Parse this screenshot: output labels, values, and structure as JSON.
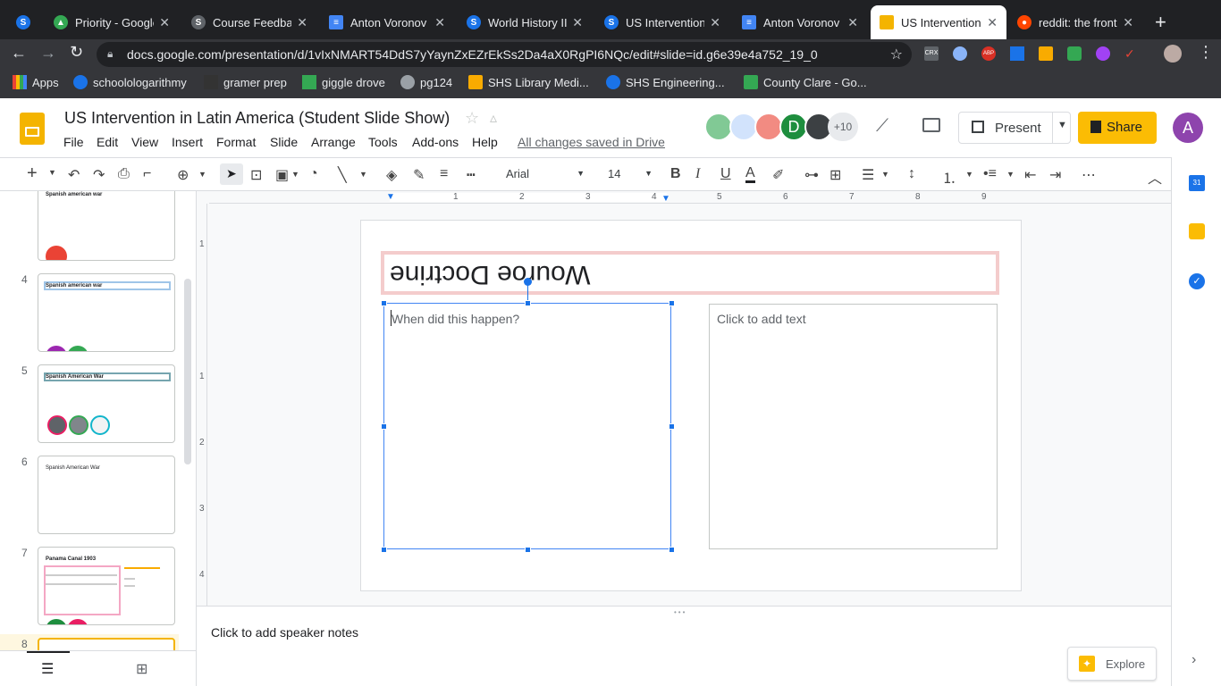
{
  "browser": {
    "tabs": [
      {
        "label": "Priority - Google",
        "color": "#1a73e8",
        "icon": "drive-icon"
      },
      {
        "label": "Course Feedback",
        "color": "#5f6368",
        "icon": "schoology-icon"
      },
      {
        "label": "Anton Voronov",
        "color": "#4285f4",
        "icon": "docs-icon"
      },
      {
        "label": "World History II",
        "color": "#1a73e8",
        "icon": "schoology-icon"
      },
      {
        "label": "US Intervention",
        "color": "#1a73e8",
        "icon": "schoology-icon"
      },
      {
        "label": "Anton Voronov",
        "color": "#4285f4",
        "icon": "docs-icon"
      },
      {
        "label": "US Intervention",
        "color": "#f4b400",
        "icon": "slides-icon",
        "active": true
      },
      {
        "label": "reddit: the front",
        "color": "#ff4500",
        "icon": "reddit-icon"
      }
    ],
    "url": "docs.google.com/presentation/d/1vIxNMART54DdS7yYaynZxEZrEkSs2Da4aX0RgPI6NQc/edit#slide=id.g6e39e4a752_19_0",
    "bookmarks": [
      "Apps",
      "schoolologarithmy",
      "gramer prep",
      "giggle drove",
      "pg124",
      "SHS Library Medi...",
      "SHS Engineering...",
      "County Clare - Go..."
    ]
  },
  "doc": {
    "title": "US Intervention in Latin America (Student Slide Show)",
    "menus": [
      "File",
      "Edit",
      "View",
      "Insert",
      "Format",
      "Slide",
      "Arrange",
      "Tools",
      "Add-ons",
      "Help"
    ],
    "saved_status": "All changes saved in Drive",
    "collaborators_more": "+10",
    "collab_initial": "D",
    "present_label": "Present",
    "share_label": "Share",
    "account_initial": "A"
  },
  "toolbar": {
    "font": "Arial",
    "font_size": "14"
  },
  "ruler": [
    "1",
    "2",
    "3",
    "4",
    "5",
    "6",
    "7",
    "8",
    "9"
  ],
  "filmstrip": {
    "slides": [
      {
        "num": "",
        "title": "Spanish american war"
      },
      {
        "num": "4",
        "title": "Spanish american war"
      },
      {
        "num": "5",
        "title": "Spanish American War"
      },
      {
        "num": "6",
        "title": "Spanish American War"
      },
      {
        "num": "7",
        "title": "Panama Canal 1903"
      },
      {
        "num": "8",
        "title": ""
      }
    ]
  },
  "slide": {
    "title": "Wouroe Doctrine",
    "left_placeholder": "When did this happen?",
    "right_placeholder": "Click to add text"
  },
  "notes": {
    "placeholder": "Click to add speaker notes",
    "explore_label": "Explore"
  }
}
